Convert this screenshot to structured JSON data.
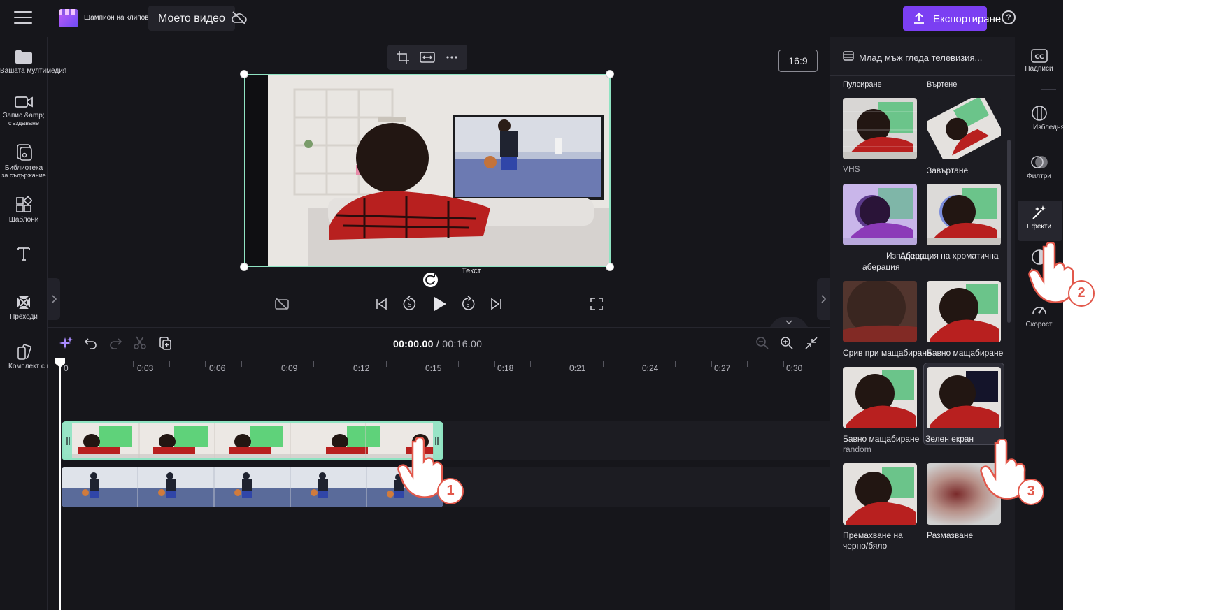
{
  "topbar": {
    "app_name": "Шампион на клиповете",
    "project_title": "Моето видео",
    "export_label": "Експортиране",
    "help": "?"
  },
  "leftnav": [
    {
      "label": "Вашата мултимедия",
      "icon": "folder-icon"
    },
    {
      "label": "Запис &amp;",
      "label2": "създаване",
      "icon": "camera-icon"
    },
    {
      "label": "Библиотека",
      "label2": "за съдържание",
      "icon": "library-icon"
    },
    {
      "label": "Шаблони",
      "icon": "templates-icon"
    },
    {
      "label": "",
      "icon": "text-icon"
    },
    {
      "label": "Преходи",
      "icon": "transitions-icon"
    },
    {
      "label": "Комплект с марки",
      "icon": "brand-kit-icon"
    }
  ],
  "preview": {
    "aspect_ratio": "16:9",
    "text_label": "Текст"
  },
  "timeline": {
    "current_time": "00:00.00",
    "separator": "/",
    "total_time": "00:16.00",
    "ticks": [
      "0",
      "0:03",
      "0:06",
      "0:09",
      "0:12",
      "0:15",
      "0:18",
      "0:21",
      "0:24",
      "0:27",
      "0:30"
    ]
  },
  "effects_panel": {
    "title": "Млад мъж гледа телевизия...",
    "section_left": "Пулсиране",
    "section_right": "Въртене",
    "cards": [
      {
        "label": "VHS",
        "label2": ""
      },
      {
        "label": "Завъртане",
        "label2": ""
      },
      {
        "label": "Изпадаща",
        "label2": "аберация"
      },
      {
        "label": "Аберация на хроматична",
        "label2": ""
      },
      {
        "label": "Срив при мащабиране",
        "label2": ""
      },
      {
        "label": "Бавно мащабиране",
        "label2": ""
      },
      {
        "label": "Бавно мащабиране",
        "label2": "random"
      },
      {
        "label": "Зелен екран",
        "label2": ""
      },
      {
        "label": "Премахване на",
        "label2": "черно/бяло"
      },
      {
        "label": "Размазване",
        "label2": ""
      }
    ]
  },
  "rightnav": [
    {
      "label": "Надписи",
      "icon": "captions-icon"
    },
    {
      "label": "Избледняване",
      "icon": "fade-icon"
    },
    {
      "label": "Филтри",
      "icon": "filters-icon"
    },
    {
      "label": "Ефекти",
      "icon": "effects-icon"
    },
    {
      "label": "А",
      "label2": "со",
      "icon": "adjust-colors-icon"
    },
    {
      "label": "Скорост",
      "icon": "speed-icon"
    }
  ],
  "steps": [
    "1",
    "2",
    "3"
  ],
  "colors": {
    "accent": "#7b3ff2",
    "selection": "#8fe3c2",
    "badge": "#e2584b"
  }
}
